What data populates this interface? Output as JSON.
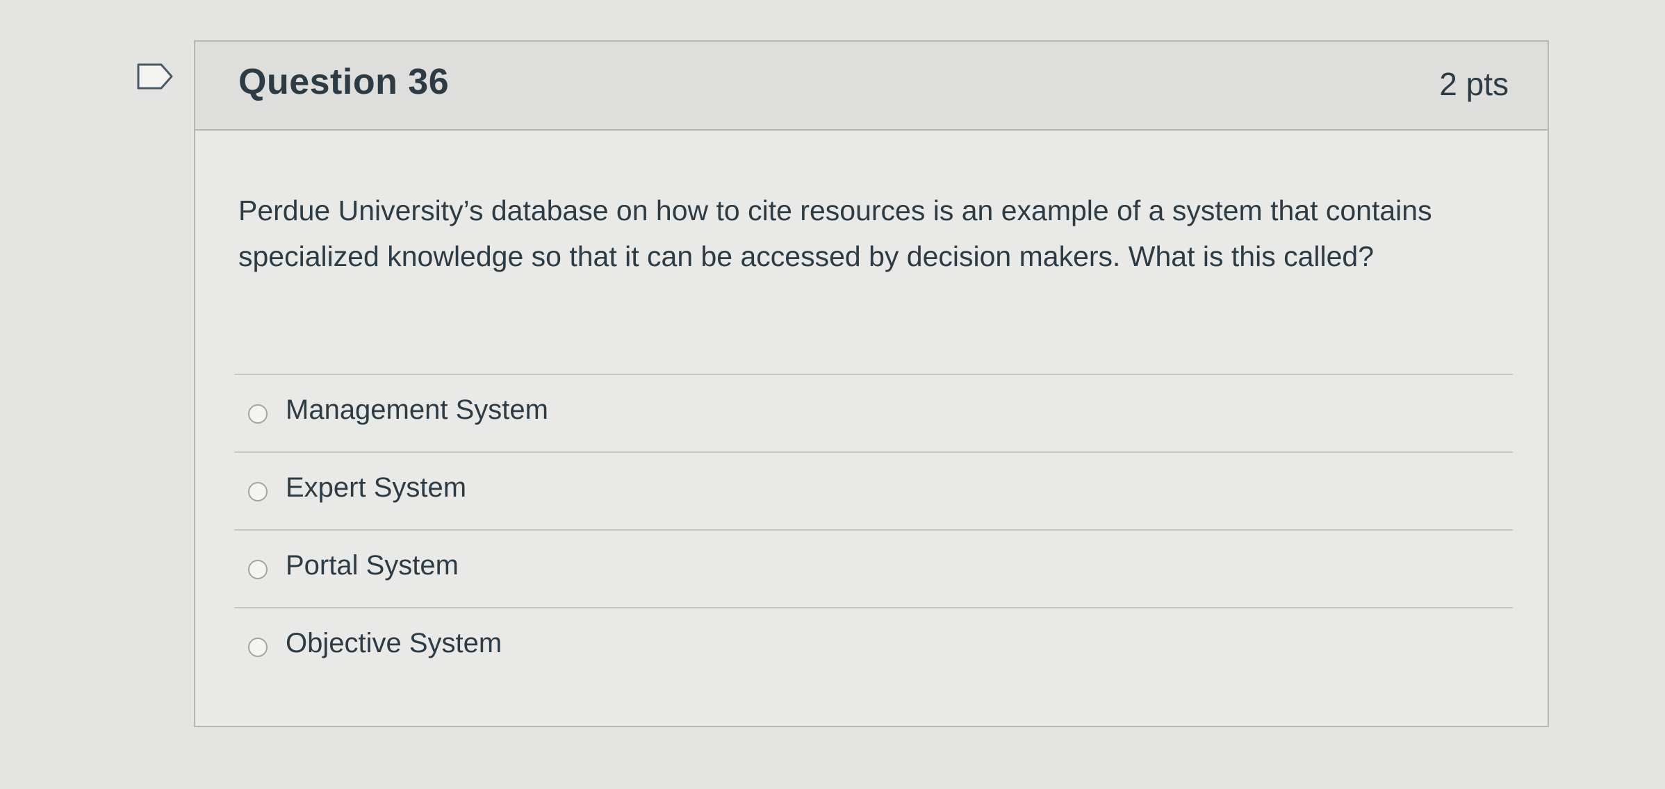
{
  "question": {
    "title": "Question 36",
    "points": "2 pts",
    "text": "Perdue University’s database on how to cite resources is an example of a system that contains specialized knowledge so that it can be accessed by decision makers. What is this called?",
    "flag_icon": "flag-icon",
    "answers": [
      {
        "label": "Management System",
        "selected": false
      },
      {
        "label": "Expert System",
        "selected": false
      },
      {
        "label": "Portal System",
        "selected": false
      },
      {
        "label": "Objective System",
        "selected": false
      }
    ]
  },
  "colors": {
    "text": "#2d3b45",
    "border": "#b7b7b5",
    "header_bg": "#dededc",
    "page_bg": "#e4e4e2"
  }
}
